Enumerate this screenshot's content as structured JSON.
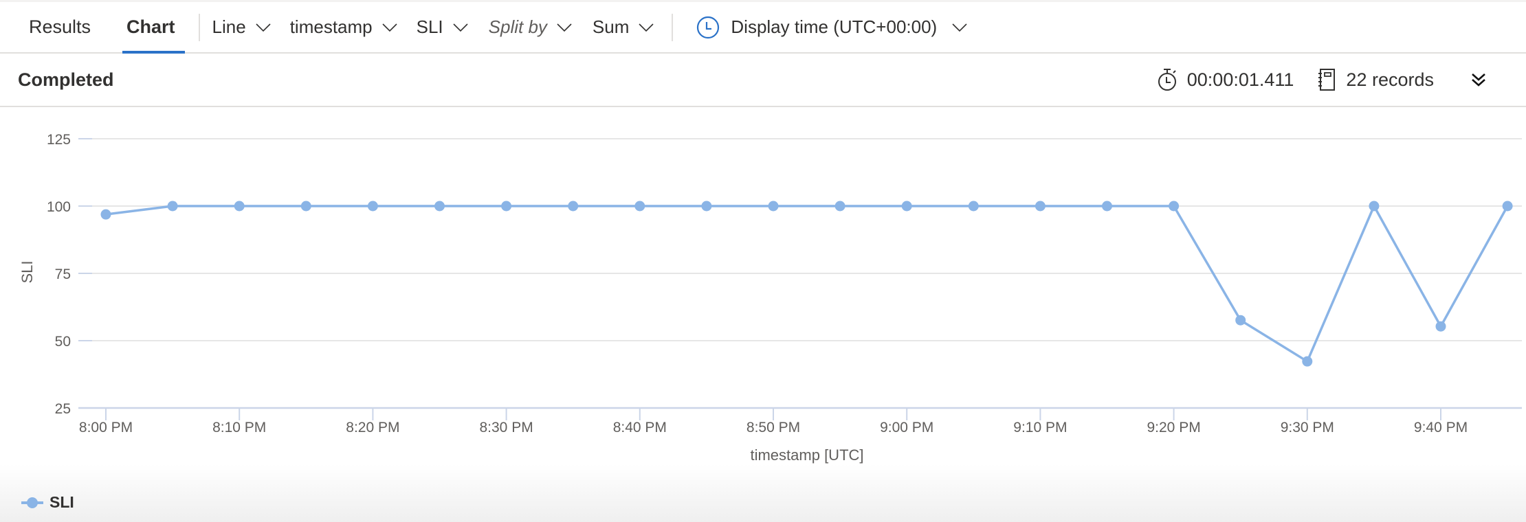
{
  "toolbar": {
    "tabs": [
      {
        "label": "Results",
        "active": false
      },
      {
        "label": "Chart",
        "active": true
      }
    ],
    "chart_type": {
      "label": "Line",
      "icon": "chevron-down-icon"
    },
    "x_column": {
      "label": "timestamp",
      "icon": "chevron-down-icon"
    },
    "y_column": {
      "label": "SLI",
      "icon": "chevron-down-icon"
    },
    "split_by": {
      "placeholder": "Split by",
      "icon": "chevron-down-icon"
    },
    "aggregation": {
      "label": "Sum",
      "icon": "chevron-down-icon"
    },
    "display_time": {
      "label": "Display time (UTC+00:00)",
      "icon": "clock-icon"
    }
  },
  "status": {
    "state": "Completed",
    "duration": "00:00:01.411",
    "duration_icon": "stopwatch-icon",
    "records": "22 records",
    "records_icon": "notebook-icon",
    "expand_icon": "double-chevron-down-icon"
  },
  "colors": {
    "series": "#8ab4e6",
    "accent": "#2b72c8",
    "grid": "#e6e6e6",
    "axis": "#cbd5e8"
  },
  "chart_data": {
    "type": "line",
    "title": "",
    "xlabel": "timestamp [UTC]",
    "ylabel": "SLI",
    "ylim": [
      25,
      125
    ],
    "yticks": [
      25,
      50,
      75,
      100,
      125
    ],
    "xtick_labels": [
      "8:00 PM",
      "8:10 PM",
      "8:20 PM",
      "8:30 PM",
      "8:40 PM",
      "8:50 PM",
      "9:00 PM",
      "9:10 PM",
      "9:20 PM",
      "9:30 PM",
      "9:40 PM"
    ],
    "grid": true,
    "legend": {
      "position": "bottom-left",
      "entries": [
        "SLI"
      ]
    },
    "x": [
      "8:00 PM",
      "8:05 PM",
      "8:10 PM",
      "8:15 PM",
      "8:20 PM",
      "8:25 PM",
      "8:30 PM",
      "8:35 PM",
      "8:40 PM",
      "8:45 PM",
      "8:50 PM",
      "8:55 PM",
      "9:00 PM",
      "9:05 PM",
      "9:10 PM",
      "9:15 PM",
      "9:20 PM",
      "9:25 PM",
      "9:30 PM",
      "9:35 PM",
      "9:40 PM",
      "9:45 PM"
    ],
    "x_minutes": [
      0,
      5,
      10,
      15,
      20,
      25,
      30,
      35,
      40,
      45,
      50,
      55,
      60,
      65,
      70,
      75,
      80,
      85,
      90,
      95,
      100,
      105
    ],
    "series": [
      {
        "name": "SLI",
        "values": [
          96.9,
          100,
          100,
          100,
          100,
          100,
          100,
          100,
          100,
          100,
          100,
          100,
          100,
          100,
          100,
          100,
          100,
          57.6,
          42.3,
          100,
          55.3,
          100
        ]
      }
    ]
  }
}
